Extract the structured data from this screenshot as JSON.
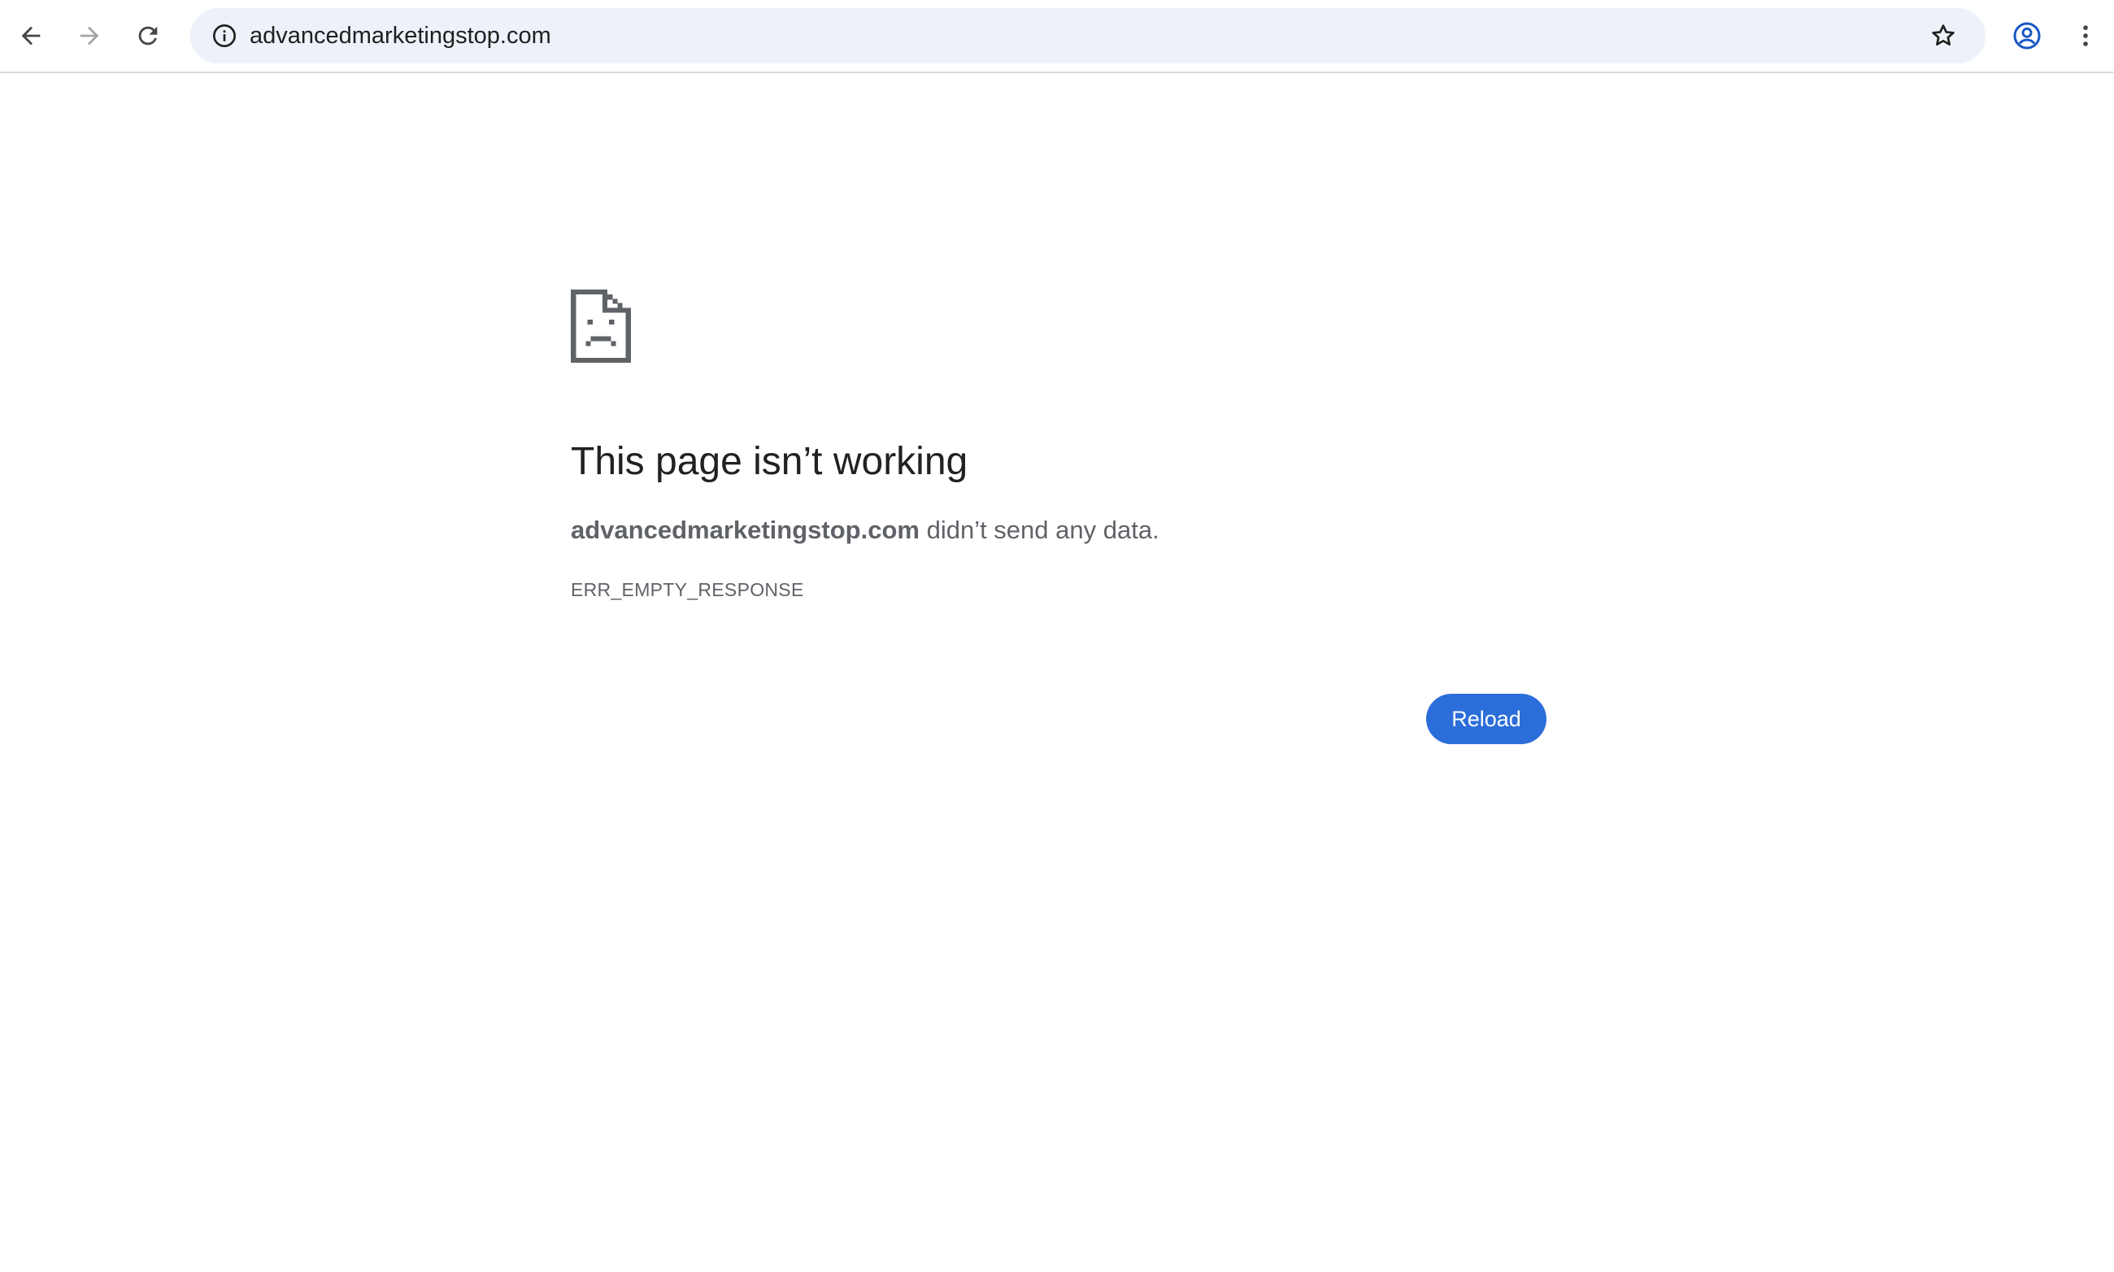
{
  "browser": {
    "nav": {
      "back_icon": "arrow-left-icon",
      "forward_icon": "arrow-right-icon",
      "reload_icon": "reload-icon"
    },
    "omnibox": {
      "info_icon": "info-icon",
      "url": "advancedmarketingstop.com",
      "bookmark_icon": "star-icon"
    },
    "profile_icon": "account-circle-icon",
    "menu_icon": "more-vertical-icon"
  },
  "error_page": {
    "icon": "sad-page-icon",
    "title": "This page isn’t working",
    "host": "advancedmarketingstop.com",
    "message": " didn’t send any data.",
    "error_code": "ERR_EMPTY_RESPONSE",
    "reload_label": "Reload"
  },
  "colors": {
    "accent": "#2c6ed9",
    "omnibox_bg": "#edf2fa",
    "title_text": "#202124",
    "secondary_text": "#5f6368",
    "profile_icon": "#1a57c6"
  }
}
